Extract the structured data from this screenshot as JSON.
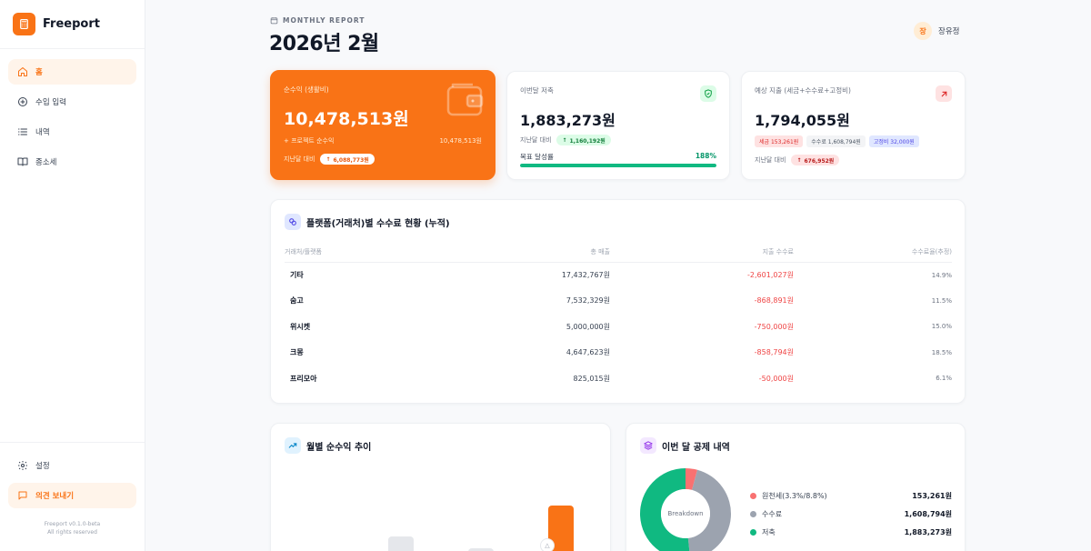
{
  "app": {
    "name": "Freeport",
    "version": "Freeport v0.1.0-beta",
    "rights": "All rights reserved"
  },
  "sidebar": {
    "items": [
      {
        "label": "홈",
        "icon": "home-icon",
        "active": true
      },
      {
        "label": "수입 입력",
        "icon": "plus-circle-icon",
        "active": false
      },
      {
        "label": "내역",
        "icon": "list-icon",
        "active": false
      },
      {
        "label": "종소세",
        "icon": "book-icon",
        "active": false
      }
    ],
    "settings": "설정",
    "feedback": "의견 보내기"
  },
  "header": {
    "eyebrow": "MONTHLY REPORT",
    "title": "2026년 2월",
    "user_initial": "장",
    "user_name": "장유정"
  },
  "cards": {
    "net_income": {
      "label": "순수익 (생활비)",
      "value": "10,478,513원",
      "project_label": "+ 프로젝트 순수익",
      "project_value": "10,478,513원",
      "compare_label": "지난달 대비",
      "compare_value": "6,088,773원"
    },
    "savings": {
      "label": "이번달 저축",
      "value": "1,883,273원",
      "compare_label": "지난달 대비",
      "compare_value": "1,160,192원",
      "goal_label": "목표 달성률",
      "goal_value": "188%",
      "goal_fill_percent": 100
    },
    "expense": {
      "label": "예상 지출 (세금+수수료+고정비)",
      "value": "1,794,055원",
      "tags": [
        {
          "label": "세금 153,261원",
          "bg": "#fee2e2",
          "color": "#dc2626"
        },
        {
          "label": "수수료 1,608,794원",
          "bg": "#f3f4f6",
          "color": "#4b5563"
        },
        {
          "label": "고정비 32,000원",
          "bg": "#e0e7ff",
          "color": "#4f46e5"
        }
      ],
      "compare_label": "지난달 대비",
      "compare_value": "676,952원"
    }
  },
  "fees_table": {
    "title": "플랫폼(거래처)별 수수료 현황 (누적)",
    "headers": [
      "거래처/플랫폼",
      "총 매출",
      "지출 수수료",
      "수수료율(추정)"
    ],
    "rows": [
      {
        "name": "기타",
        "sales": "17,432,767원",
        "fee": "-2,601,027원",
        "rate": "14.9%"
      },
      {
        "name": "숨고",
        "sales": "7,532,329원",
        "fee": "-868,891원",
        "rate": "11.5%"
      },
      {
        "name": "위시켓",
        "sales": "5,000,000원",
        "fee": "-750,000원",
        "rate": "15.0%"
      },
      {
        "name": "크몽",
        "sales": "4,647,623원",
        "fee": "-858,794원",
        "rate": "18.5%"
      },
      {
        "name": "프리모아",
        "sales": "825,015원",
        "fee": "-50,000원",
        "rate": "6.1%"
      }
    ]
  },
  "trend": {
    "title": "월별 순수익 추이"
  },
  "deductions": {
    "title": "이번 달 공제 내역",
    "center_label": "Breakdown",
    "items": [
      {
        "label": "원천세(3.3%/8.8%)",
        "value": "153,261원",
        "amount": 153261,
        "color": "#f87171"
      },
      {
        "label": "수수료",
        "value": "1,608,794원",
        "amount": 1608794,
        "color": "#9ca3af"
      },
      {
        "label": "저축",
        "value": "1,883,273원",
        "amount": 1883273,
        "color": "#10b981"
      }
    ]
  },
  "colors": {
    "accent": "#f97316",
    "positive": "#10b981",
    "negative": "#ef4444"
  }
}
